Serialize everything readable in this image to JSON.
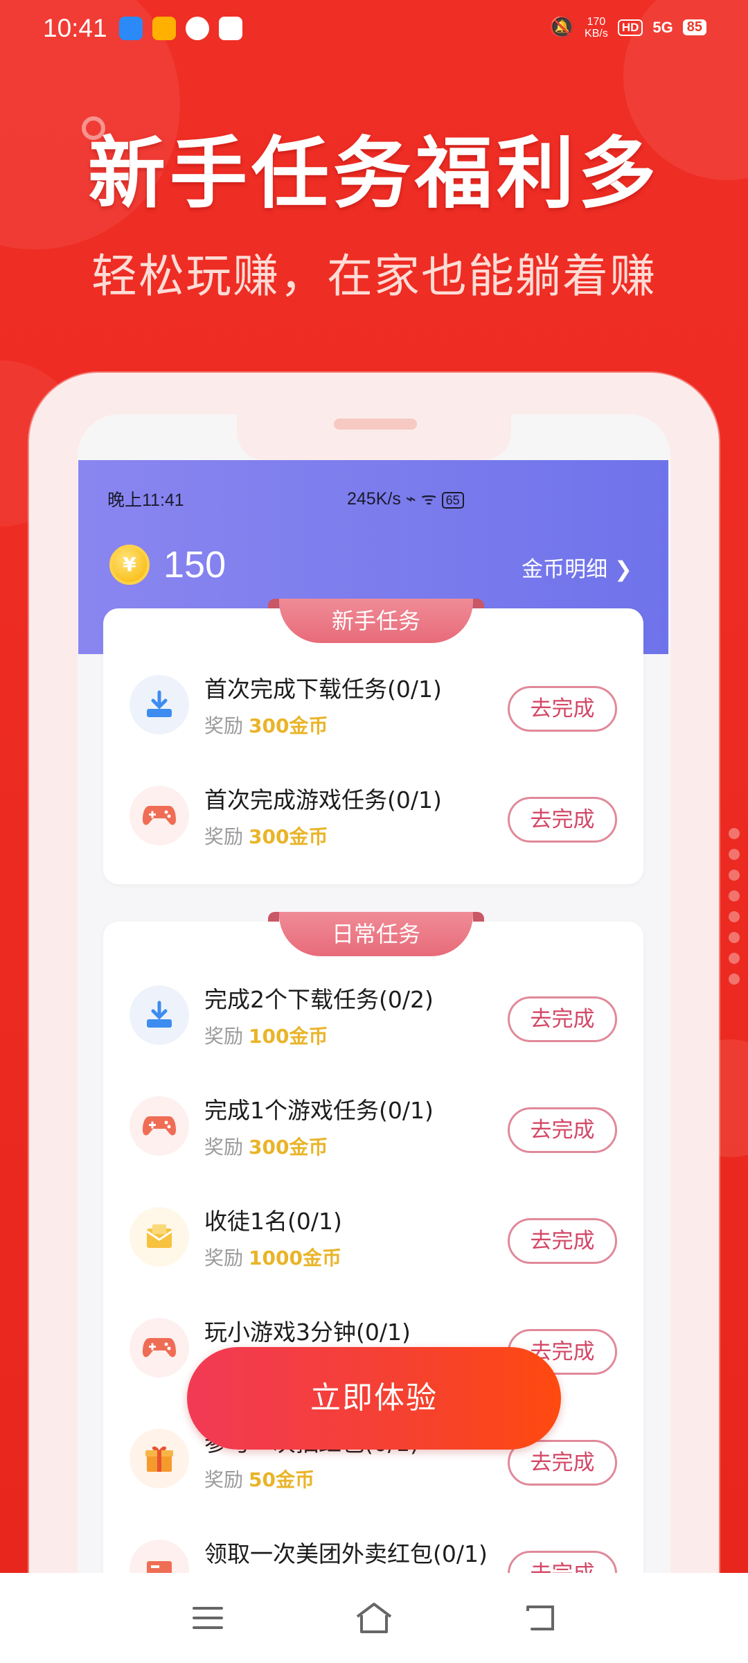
{
  "status_bar": {
    "time": "10:41",
    "net_speed_value": "170",
    "net_speed_unit": "KB/s",
    "hd": "HD",
    "signal": "5G",
    "battery": "85"
  },
  "banner": {
    "headline": "新手任务福利多",
    "subheadline": "轻松玩赚，在家也能躺着赚"
  },
  "inner_status": {
    "time": "晚上11:41",
    "right": "245K/s",
    "battery": "65"
  },
  "coins": {
    "symbol": "¥",
    "balance": "150",
    "detail_label": "金币明细 ❯"
  },
  "sections": {
    "newbie": {
      "title": "新手任务",
      "tasks": [
        {
          "title": "首次完成下载任务(0/1)",
          "reward_label": "奖励",
          "reward": "300金币",
          "button": "去完成",
          "icon": "download-icon"
        },
        {
          "title": "首次完成游戏任务(0/1)",
          "reward_label": "奖励",
          "reward": "300金币",
          "button": "去完成",
          "icon": "gamepad-icon"
        }
      ]
    },
    "daily": {
      "title": "日常任务",
      "tasks": [
        {
          "title": "完成2个下载任务(0/2)",
          "reward_label": "奖励",
          "reward": "100金币",
          "button": "去完成",
          "icon": "download-icon"
        },
        {
          "title": "完成1个游戏任务(0/1)",
          "reward_label": "奖励",
          "reward": "300金币",
          "button": "去完成",
          "icon": "gamepad-icon"
        },
        {
          "title": "收徒1名(0/1)",
          "reward_label": "奖励",
          "reward": "1000金币",
          "button": "去完成",
          "icon": "envelope-icon"
        },
        {
          "title": "玩小游戏3分钟(0/1)",
          "reward_label": "奖励",
          "reward": "",
          "button": "去完成",
          "icon": "gamepad-icon"
        },
        {
          "title": "参与一次抽红包(0/1)",
          "reward_label": "奖励",
          "reward": "50金币",
          "button": "去完成",
          "icon": "gift-icon"
        },
        {
          "title": "领取一次美团外卖红包(0/1)",
          "reward_label": "",
          "reward": "",
          "button": "去完成",
          "icon": "coupon-icon"
        }
      ]
    }
  },
  "cta": {
    "label": "立即体验"
  },
  "colors": {
    "background": "#ee2e24",
    "header_gradient_start": "#8a86f0",
    "header_gradient_end": "#6f73ea",
    "reward": "#e9b429",
    "button_text": "#d34766",
    "cta_start": "#f23a55",
    "cta_end": "#ff4a10"
  }
}
